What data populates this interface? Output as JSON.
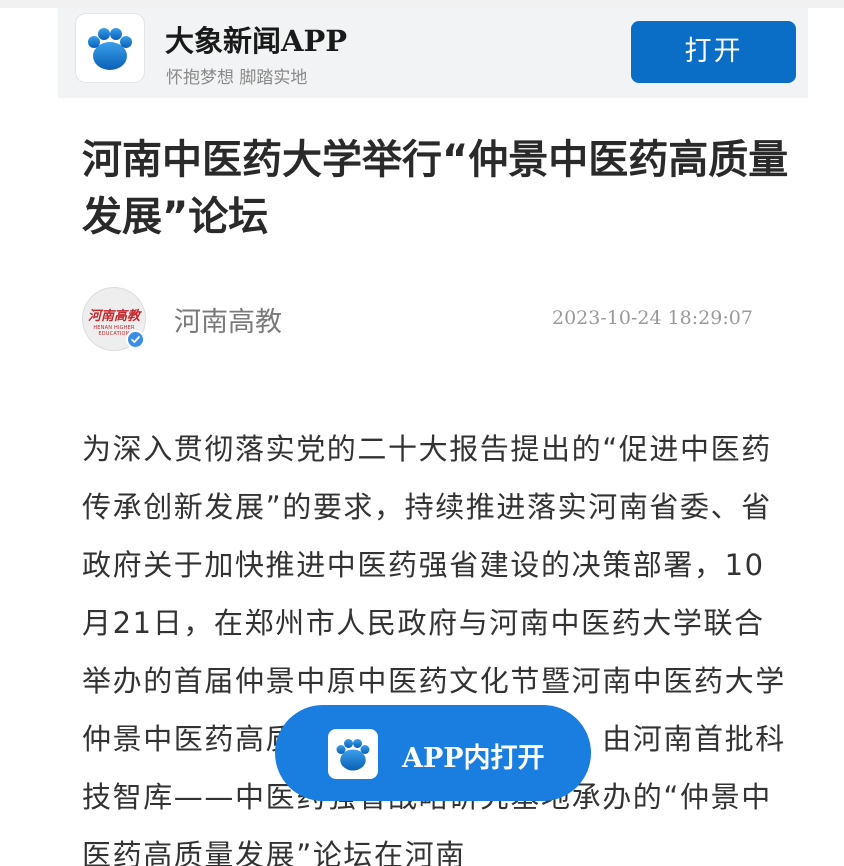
{
  "colors": {
    "brand_blue": "#0a6ec6",
    "float_button_blue": "#1a7de0",
    "avatar_red": "#c1272d",
    "verified_blue": "#3a8ee6"
  },
  "app_banner": {
    "logo_icon": "paw-logo-icon",
    "app_name": "大象新闻APP",
    "slogan": "怀抱梦想 脚踏实地",
    "open_label": "打开"
  },
  "article": {
    "title": "河南中医药大学举行“仲景中医药高质量发展”论坛",
    "author": {
      "name": "河南高教",
      "avatar_text": "河南高教",
      "avatar_subtext": "HENAN HIGHER EDUCATION",
      "verified_icon": "verified-check-icon"
    },
    "publish_time": "2023-10-24 18:29:07",
    "body": "为深入贯彻落实党的二十大报告提出的“促进中医药传承创新发展”的要求，持续推进落实河南省委、省政府关于加快推进中医药强省建设的决策部署，10月21日，在郑州市人民政府与河南中医药大学联合举办的首届仲景中原中医药文化节暨河南中医药大学仲景中医药高质量发展论坛开幕式后，由河南首批科技智库——中医药强省战略研究基地承办的“仲景中医药高质量发展”论坛在河南"
  },
  "float_button": {
    "logo_icon": "paw-logo-icon",
    "label": "APP内打开"
  }
}
